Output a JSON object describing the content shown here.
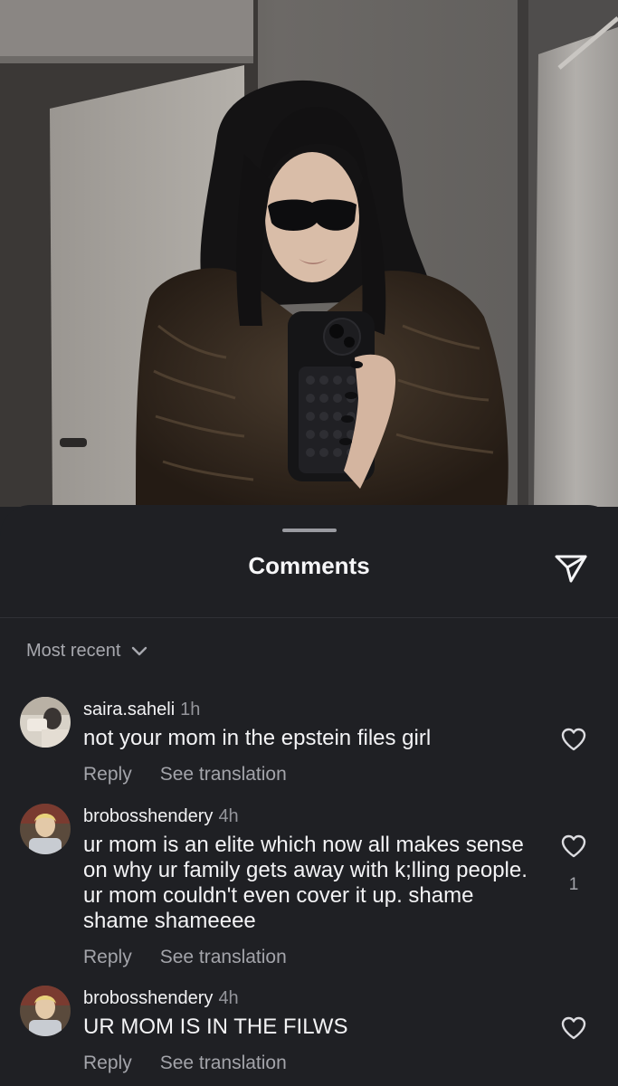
{
  "sheet": {
    "title": "Comments",
    "sort_label": "Most recent"
  },
  "comments": [
    {
      "username": "saira.saheli",
      "time": "1h",
      "text": "not your mom in the epstein files girl",
      "reply_label": "Reply",
      "translate_label": "See translation",
      "likes": ""
    },
    {
      "username": "brobosshendery",
      "time": "4h",
      "text": "ur mom is an elite which now all makes sense on why ur family gets away with k;lling people. ur mom couldn't even cover it up. shame shame shameeee",
      "reply_label": "Reply",
      "translate_label": "See translation",
      "likes": "1"
    },
    {
      "username": "brobosshendery",
      "time": "4h",
      "text": "UR MOM IS IN THE FILWS",
      "reply_label": "Reply",
      "translate_label": "See translation",
      "likes": ""
    }
  ],
  "icons": {
    "share": "paper-plane-icon",
    "sort": "chevron-down-icon",
    "like": "heart-icon"
  },
  "colors": {
    "sheet_background": "#1f2024",
    "primary_text": "#f2f2f4",
    "secondary_text": "#a3a4aa"
  }
}
